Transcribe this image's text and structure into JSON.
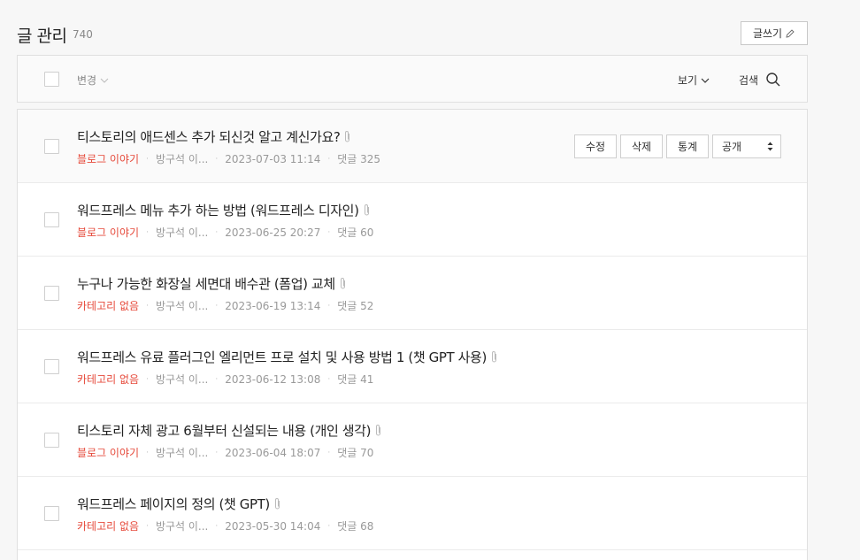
{
  "header": {
    "title": "글 관리",
    "count": "740",
    "write_label": "글쓰기"
  },
  "toolbar": {
    "change_label": "변경",
    "view_label": "보기",
    "search_label": "검색"
  },
  "row_actions": {
    "edit": "수정",
    "delete": "삭제",
    "stats": "통계",
    "visibility": "공개"
  },
  "posts": [
    {
      "title": "티스토리의 애드센스 추가 되신것 알고 계신가요?",
      "category": "블로그 이야기",
      "author": "방구석 이...",
      "date": "2023-07-03 11:14",
      "comments": "댓글 325"
    },
    {
      "title": "워드프레스 메뉴 추가 하는 방법 (워드프레스 디자인)",
      "category": "블로그 이야기",
      "author": "방구석 이...",
      "date": "2023-06-25 20:27",
      "comments": "댓글 60"
    },
    {
      "title": "누구나 가능한 화장실 세면대 배수관 (폼업) 교체",
      "category": "카테고리 없음",
      "author": "방구석 이...",
      "date": "2023-06-19 13:14",
      "comments": "댓글 52"
    },
    {
      "title": "워드프레스 유료 플러그인 엘리먼트 프로 설치 및 사용 방법 1 (챗 GPT 사용)",
      "category": "카테고리 없음",
      "author": "방구석 이...",
      "date": "2023-06-12 13:08",
      "comments": "댓글 41"
    },
    {
      "title": "티스토리 자체 광고 6월부터 신설되는 내용 (개인 생각)",
      "category": "블로그 이야기",
      "author": "방구석 이...",
      "date": "2023-06-04 18:07",
      "comments": "댓글 70"
    },
    {
      "title": "워드프레스 페이지의 정의 (챗 GPT)",
      "category": "카테고리 없음",
      "author": "방구석 이...",
      "date": "2023-05-30 14:04",
      "comments": "댓글 68"
    }
  ],
  "colors": {
    "category": "#e64a3b",
    "muted": "#999999"
  }
}
